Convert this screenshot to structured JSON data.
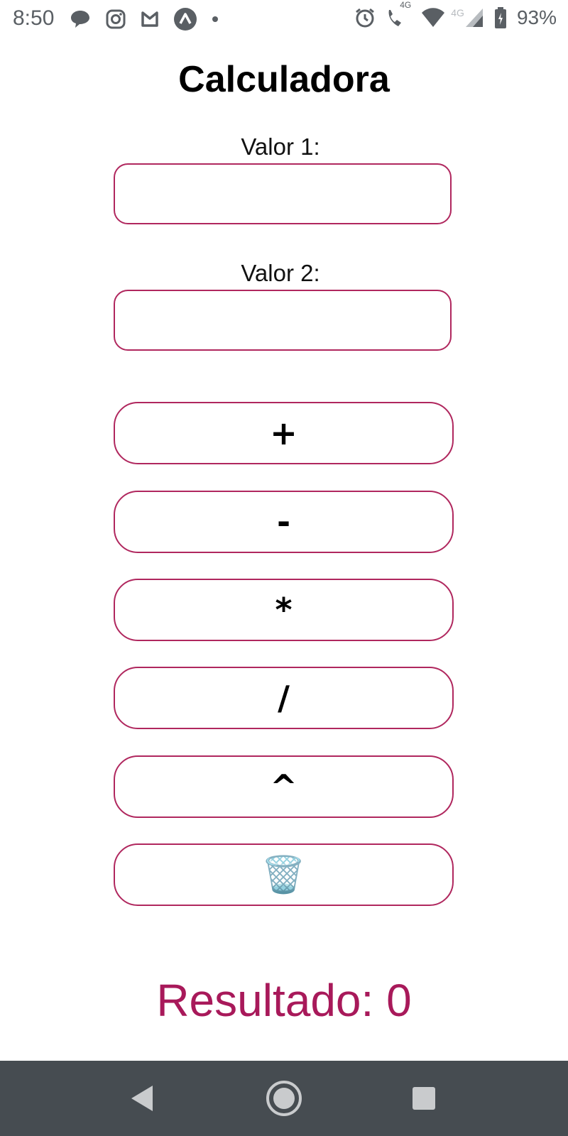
{
  "status_bar": {
    "time": "8:50",
    "left_icons": [
      "messages-icon",
      "instagram-icon",
      "mail-icon",
      "expo-icon",
      "dot-icon"
    ],
    "network_badge_1": "4G",
    "network_badge_2": "4G",
    "battery_percent": "93%"
  },
  "app": {
    "title": "Calculadora",
    "value1_label": "Valor 1:",
    "value1": "",
    "value2_label": "Valor 2:",
    "value2": "",
    "buttons": [
      {
        "label": "+",
        "name": "add"
      },
      {
        "label": "-",
        "name": "subtract"
      },
      {
        "label": "*",
        "name": "multiply"
      },
      {
        "label": "/",
        "name": "divide"
      },
      {
        "label": "^",
        "name": "power"
      },
      {
        "label": "🗑️",
        "name": "clear"
      }
    ],
    "result": "Resultado: 0"
  },
  "nav_bar": {
    "buttons": [
      "back",
      "home",
      "recents"
    ]
  },
  "colors": {
    "accent": "#b0275e",
    "result_text": "#a8195a",
    "nav_bar_bg": "#464c51"
  }
}
